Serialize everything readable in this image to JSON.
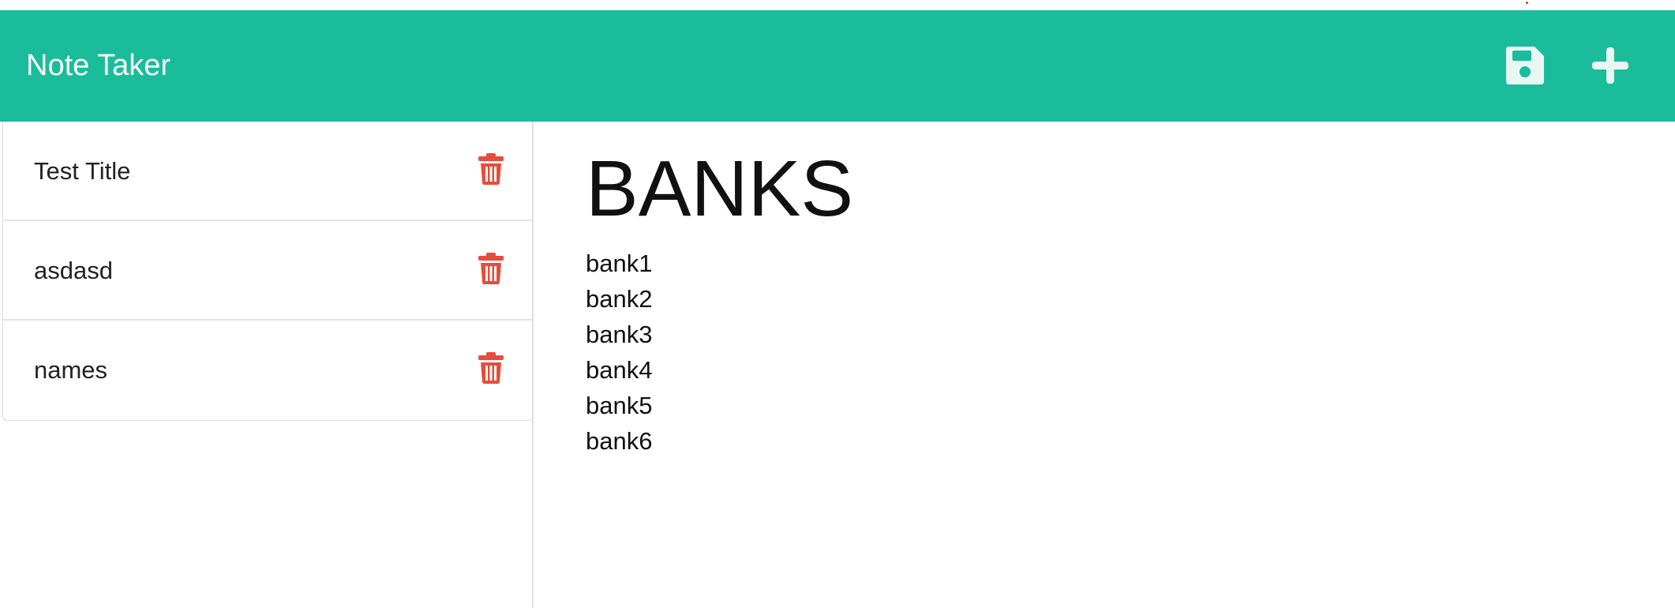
{
  "app": {
    "title": "Note Taker"
  },
  "navbar": {
    "actions": [
      {
        "name": "save",
        "icon": "save-icon"
      },
      {
        "name": "new-note",
        "icon": "plus-icon"
      }
    ]
  },
  "notes": [
    {
      "title": "Test Title",
      "delete_icon": "trash-icon"
    },
    {
      "title": "asdasd",
      "delete_icon": "trash-icon"
    },
    {
      "title": "names",
      "delete_icon": "trash-icon"
    }
  ],
  "active_note": {
    "title": "BANKS",
    "text": "bank1\nbank2\nbank3\nbank4\nbank5\nbank6"
  },
  "colors": {
    "accent": "#1abc9c",
    "danger": "#e74c3c",
    "icon_light": "#e9f7f3"
  }
}
